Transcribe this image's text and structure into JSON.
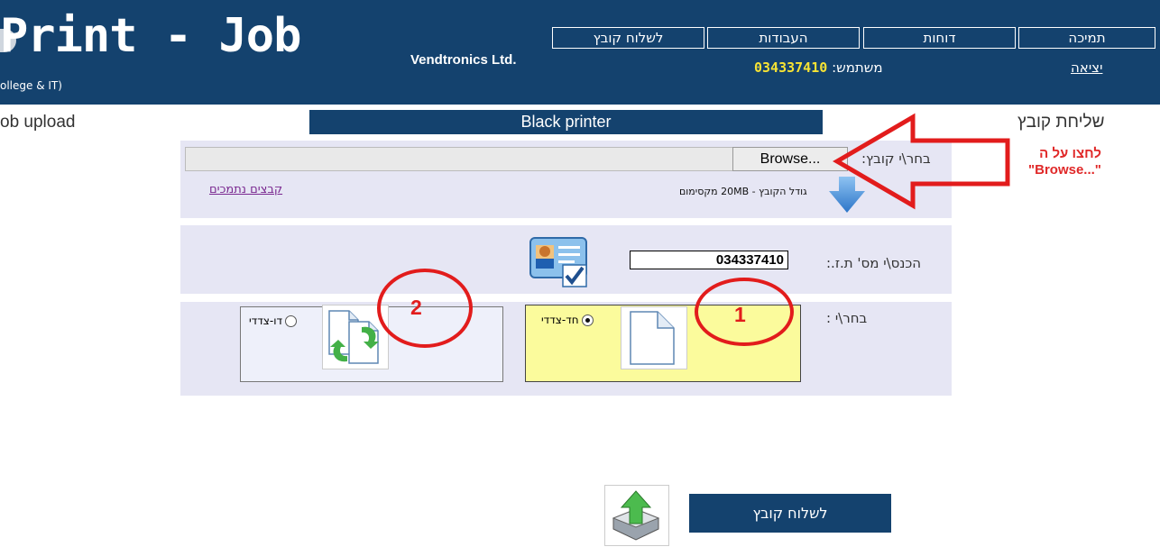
{
  "header": {
    "brand": "Print - Job",
    "vendor": "Vendtronics Ltd.",
    "college": "ollege & IT)",
    "nav": [
      "לשלוח קובץ",
      "העבודות",
      "דוחות",
      "תמיכה"
    ],
    "user_label": "משתמש:",
    "user_id": "034337410",
    "logout": "יציאה"
  },
  "page": {
    "left_title": "ob upload",
    "right_title": "שליחת קובץ",
    "printer": "Black printer"
  },
  "upload": {
    "choose_file_label": "בחר\\י קובץ:",
    "browse": "Browse...",
    "max_size": "גודל הקובץ - 20MB מקסימום",
    "supported_files": "קבצים נתמכים"
  },
  "id_section": {
    "label": "הכנס\\י מס' ת.ז.:",
    "value": "034337410"
  },
  "mode": {
    "label": "בחר\\י :",
    "single_sided": "חד-צדדי",
    "double_sided": "דו-צדדי",
    "selected": "single_sided"
  },
  "submit": {
    "label": "לשלוח קובץ"
  },
  "annotations": {
    "hint_line1": "לחצו על ה",
    "hint_line2": "\"Browse...\"",
    "circle_1": "1",
    "circle_2": "2",
    "color": "#e21c1c"
  },
  "colors": {
    "header_bg": "#14426e",
    "panel_bg": "#e6e6f4",
    "selected_option_bg": "#fbfb9c",
    "user_id_color": "#f7e334"
  }
}
